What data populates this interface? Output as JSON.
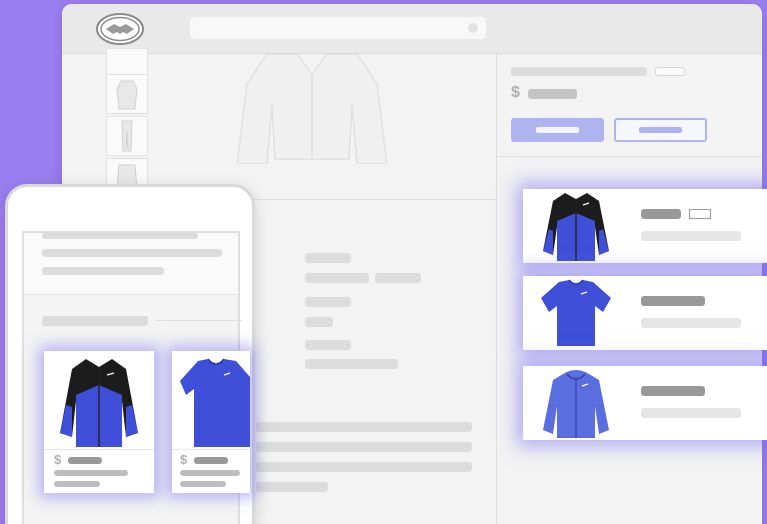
{
  "colors": {
    "background": "#9a7ff0",
    "accent": "#aeb4f0",
    "glow": "#7f74ec",
    "product_blue": "#3f4fd8",
    "product_black": "#1c1c1c"
  },
  "desktop": {
    "logo_icon": "handshake-icon",
    "product_price": {
      "currency_symbol": "$"
    }
  },
  "recommendations": [
    {
      "icon": "jacket-icon"
    },
    {
      "icon": "tshirt-icon"
    },
    {
      "icon": "hoodie-icon"
    }
  ],
  "mobile": {
    "cards": [
      {
        "icon": "jacket-icon",
        "currency_symbol": "$"
      },
      {
        "icon": "tshirt-icon",
        "currency_symbol": "$"
      }
    ]
  }
}
